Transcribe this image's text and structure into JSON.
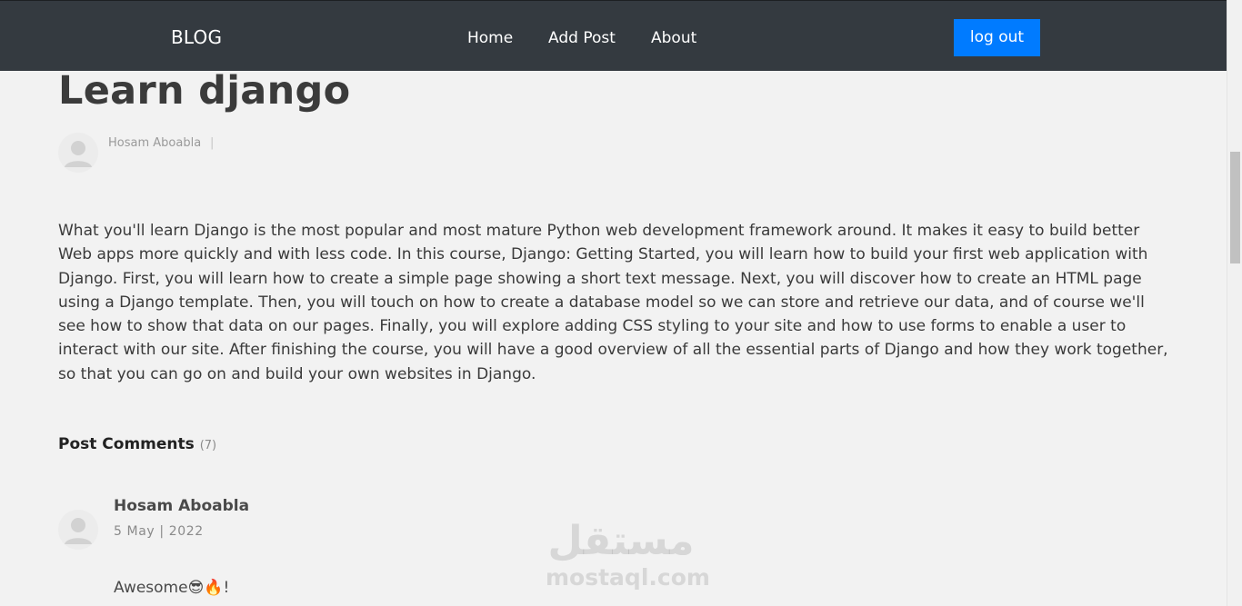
{
  "navbar": {
    "brand": "BLOG",
    "links": [
      "Home",
      "Add Post",
      "About"
    ],
    "logout_label": "log out",
    "logout_color": "#007bff",
    "background": "#343a40"
  },
  "post": {
    "title": "Learn django",
    "author": "Hosam Aboabla",
    "author_separator": "|",
    "body": "What you'll learn Django is the most popular and most mature Python web development framework around. It makes it easy to build better Web apps more quickly and with less code. In this course, Django: Getting Started, you will learn how to build your first web application with Django. First, you will learn how to create a simple page showing a short text message. Next, you will discover how to create an HTML page using a Django template. Then, you will touch on how to create a database model so we can store and retrieve our data, and of course we'll see how to show that data on our pages. Finally, you will explore adding CSS styling to your site and how to use forms to enable a user to interact with our site. After finishing the course, you will have a good overview of all the essential parts of Django and how they work together, so that you can go on and build your own websites in Django."
  },
  "comments": {
    "heading": "Post Comments",
    "count": "(7)",
    "items": [
      {
        "author": "Hosam Aboabla",
        "date": "5 May | 2022",
        "text": "Awesome😎🔥!"
      }
    ]
  },
  "watermark": {
    "arabic": "مستقل",
    "latin": "mostaql.com"
  },
  "icons": {
    "avatar": "user-avatar-icon"
  }
}
